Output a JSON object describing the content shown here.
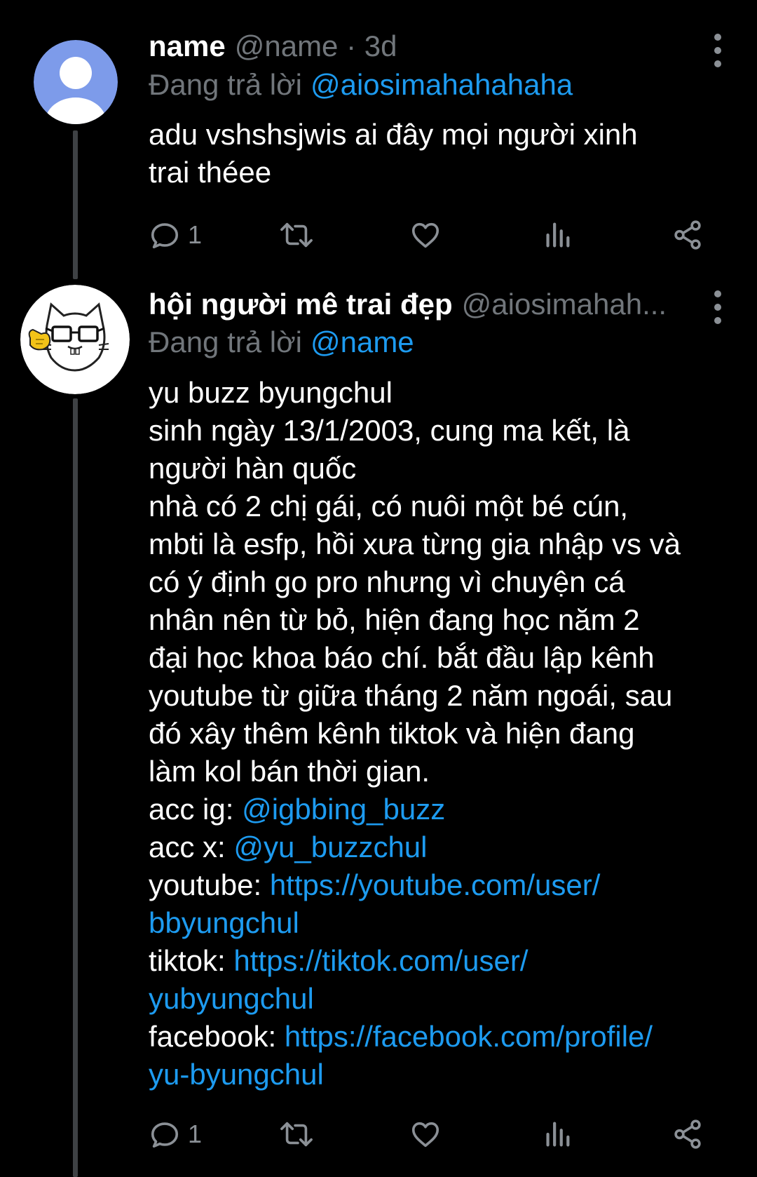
{
  "tweets": [
    {
      "display_name": "name",
      "handle_meta": "@name · 3d",
      "reply_prefix": "Đang trả lời",
      "reply_to": "@aiosimahahahaha",
      "lines": [
        {
          "text": "adu vshshsjwis ai đây mọi người xinh"
        },
        {
          "text": "trai théee"
        }
      ],
      "actions": {
        "reply_count": "1",
        "retweet_count": "",
        "like_count": ""
      },
      "avatar_icon": "default-user-avatar-icon"
    },
    {
      "display_name": "hội người mê trai đẹp",
      "handle_meta": "@aiosimahah...",
      "reply_prefix": "Đang trả lời",
      "reply_to": "@name",
      "lines": [
        {
          "text": "yu buzz byungchul"
        },
        {
          "text": "sinh ngày 13/1/2003, cung ma kết, là"
        },
        {
          "text": "người hàn quốc"
        },
        {
          "text": "nhà có 2 chị gái, có nuôi một bé cún,"
        },
        {
          "text": "mbti là esfp, hồi xưa từng gia nhập vs và"
        },
        {
          "text": "có ý định go pro nhưng vì chuyện cá"
        },
        {
          "text": "nhân nên từ bỏ, hiện đang học năm 2"
        },
        {
          "text": "đại học khoa báo chí. bắt đầu lập kênh"
        },
        {
          "text": "youtube từ giữa tháng 2 năm ngoái, sau"
        },
        {
          "text": "đó xây thêm kênh tiktok và hiện đang"
        },
        {
          "text": "làm kol bán thời gian."
        },
        {
          "text": "acc ig: ",
          "link": "@igbbing_buzz"
        },
        {
          "text": "acc x: ",
          "link": "@yu_buzzchul"
        },
        {
          "text": "youtube: ",
          "link": "https://youtube.com/user/"
        },
        {
          "text": "",
          "link": "bbyungchul"
        },
        {
          "text": "tiktok: ",
          "link": "https://tiktok.com/user/"
        },
        {
          "text": "",
          "link": "yubyungchul"
        },
        {
          "text": "facebook: ",
          "link": "https://facebook.com/profile/"
        },
        {
          "text": "",
          "link": "yu-byungchul"
        }
      ],
      "actions": {
        "reply_count": "1",
        "retweet_count": "",
        "like_count": ""
      },
      "avatar_icon": "cartoon-cat-with-glasses-avatar-icon"
    }
  ],
  "icons": {
    "reply": "reply-bubble-icon",
    "retweet": "retweet-icon",
    "like": "heart-icon",
    "views": "bar-chart-icon",
    "share": "share-icon",
    "more": "more-vertical-icon"
  },
  "colors": {
    "background": "#000000",
    "text": "#ffffff",
    "secondary": "#71767b",
    "link": "#1d9bf0",
    "thread_line": "#3e4144"
  }
}
